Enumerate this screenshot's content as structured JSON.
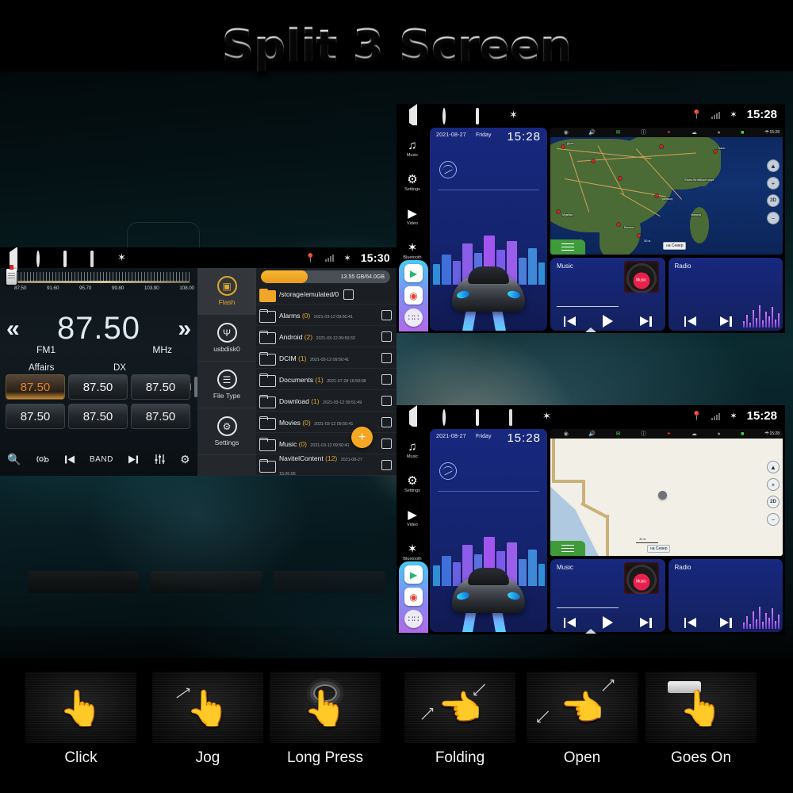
{
  "page": {
    "title": "Split 3 Screen"
  },
  "radio": {
    "statusbar": {
      "icons": [
        "back-icon",
        "home-icon",
        "recents-icon",
        "screenshot-icon",
        "bluetooth-icon"
      ]
    },
    "scale_labels": [
      "87.50",
      "91.60",
      "95.70",
      "99.80",
      "103.90",
      "108.00"
    ],
    "frequency": "87.50",
    "band": "FM1",
    "unit": "MHz",
    "program_type": "Affairs",
    "sensitivity": "DX",
    "rds_badge": "RDS",
    "prev_icon": "«",
    "next_icon": "»",
    "presets": [
      "87.50",
      "87.50",
      "87.50",
      "87.50",
      "87.50",
      "87.50"
    ],
    "active_preset_index": 0,
    "toolbar": {
      "search": "🔍",
      "scan": "((•))",
      "prev": "prev",
      "band": "BAND",
      "next": "next",
      "equalizer": "eq",
      "settings": "⚙"
    }
  },
  "filemanager": {
    "statusbar": {
      "time": "15:30",
      "location_icon": "📍",
      "bluetooth_icon": "✶"
    },
    "sidebar": [
      {
        "label": "Flash",
        "icon": "chip-icon",
        "glyph": "▣",
        "active": true
      },
      {
        "label": "usbdisk0",
        "icon": "usb-icon",
        "glyph": "Ψ",
        "active": false
      },
      {
        "label": "File Type",
        "icon": "list-icon",
        "glyph": "☰",
        "active": false
      },
      {
        "label": "Settings",
        "icon": "gear-icon",
        "glyph": "⚙",
        "active": false
      }
    ],
    "storage": {
      "text": "13.55 GB/64.0GB",
      "percent": 21
    },
    "current_path": "/storage/emulated/0",
    "files": [
      {
        "name": "Alarms",
        "count": "(0)",
        "date": "2021-03-12 09:50:41"
      },
      {
        "name": "Android",
        "count": "(2)",
        "date": "2021-03-12 09:50:33"
      },
      {
        "name": "DCIM",
        "count": "(1)",
        "date": "2021-03-12 09:50:41"
      },
      {
        "name": "Documents",
        "count": "(1)",
        "date": "2021-07-28 16:50:08"
      },
      {
        "name": "Download",
        "count": "(1)",
        "date": "2021-03-12 09:51:49"
      },
      {
        "name": "Movies",
        "count": "(0)",
        "date": "2021-03-12 09:50:41"
      },
      {
        "name": "Music",
        "count": "(0)",
        "date": "2021-03-12 09:50:41"
      },
      {
        "name": "NavitelContent",
        "count": "(12)",
        "date": "2021-08-27 15:26:06"
      }
    ],
    "fab_label": "+"
  },
  "splitscreen": {
    "statusbar": {
      "time": "15:28"
    },
    "sidebar": [
      {
        "label": "Music",
        "glyph": "♫"
      },
      {
        "label": "Settings",
        "glyph": "⚙"
      },
      {
        "label": "Video",
        "glyph": "▶"
      },
      {
        "label": "Bluetooth",
        "glyph": "✶"
      }
    ],
    "apps": [
      {
        "name": "play-store-icon",
        "glyph": "▶"
      },
      {
        "name": "chrome-icon",
        "glyph": "◉"
      },
      {
        "name": "app-drawer-icon",
        "glyph": "⁙"
      }
    ],
    "clock_widget": {
      "date": "2021-08-27",
      "day": "Friday",
      "time": "15:28"
    },
    "map": {
      "toolbar_time": "15:28",
      "menu_icon": "hamburger-icon",
      "north_label": "на Север",
      "scale_text": "30 м",
      "controls": [
        "compass-icon",
        "+",
        "2D",
        "−"
      ],
      "labels_asia": [
        "Пекин",
        "Токио",
        "Шанхай",
        "Дели",
        "Мумбаи",
        "Бангкок",
        "Гуанчжоу",
        "Манила",
        "Южно-Китайское море",
        "Филиппинское море"
      ]
    },
    "music_widget": {
      "title": "Music",
      "album_label": "Music"
    },
    "radio_widget": {
      "title": "Radio"
    }
  },
  "gestures": [
    {
      "label": "Click",
      "icon": "hand-pointer-icon"
    },
    {
      "label": "Jog",
      "icon": "hand-swipe-icon"
    },
    {
      "label": "Long Press",
      "icon": "hand-long-press-icon"
    },
    {
      "label": "Folding",
      "icon": "hand-pinch-in-icon"
    },
    {
      "label": "Open",
      "icon": "hand-pinch-out-icon"
    },
    {
      "label": "Goes On",
      "icon": "hand-drag-icon"
    }
  ]
}
